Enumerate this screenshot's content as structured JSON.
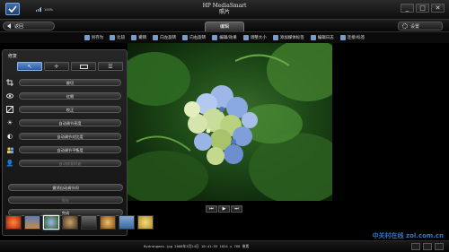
{
  "app": {
    "title_line1": "HP MediaSmart",
    "title_line2": "照片",
    "battery_pct": "100%"
  },
  "window_controls": {
    "minimize": "_",
    "maximize": "□",
    "close": "✕"
  },
  "nav": {
    "back_label": "返回",
    "active_tab": "编辑",
    "settings_label": "设置"
  },
  "toolbar": [
    {
      "label": "另存为",
      "icon": "save-as-icon"
    },
    {
      "label": "比较",
      "icon": "compare-icon"
    },
    {
      "label": "撤销",
      "icon": "undo-icon"
    },
    {
      "label": "向左旋转",
      "icon": "rotate-left-icon"
    },
    {
      "label": "向右旋转",
      "icon": "rotate-right-icon"
    },
    {
      "label": "编辑/效果",
      "icon": "effects-icon"
    },
    {
      "label": "调整大小",
      "icon": "resize-icon"
    },
    {
      "label": "添加媒体标签",
      "icon": "tag-icon"
    },
    {
      "label": "编辑日志",
      "icon": "log-icon"
    },
    {
      "label": "连接/标签",
      "icon": "link-icon"
    }
  ],
  "panel": {
    "title": "修复",
    "actions": [
      {
        "label": "裁切",
        "icon": "crop-icon",
        "enabled": true
      },
      {
        "label": "红眼",
        "icon": "red-eye-icon",
        "enabled": true
      },
      {
        "label": "校正",
        "icon": "straighten-icon",
        "enabled": true
      },
      {
        "label": "自动调节亮度",
        "icon": "brightness-icon",
        "enabled": true
      },
      {
        "label": "自动调节对比度",
        "icon": "contrast-icon",
        "enabled": true
      },
      {
        "label": "自动调节平衡度",
        "icon": "balance-icon",
        "enabled": true
      },
      {
        "label": "自动修复瑕疵",
        "icon": "fix-icon",
        "enabled": false
      }
    ],
    "wide_actions": [
      {
        "label": "撤消自动调节间",
        "enabled": true
      },
      {
        "label": "保存",
        "enabled": false
      },
      {
        "label": "完成",
        "enabled": true
      }
    ]
  },
  "status": {
    "file_info": "Hydrangeas.jpg   2008年3月24日 10:41:55    1024 x 768 像素"
  },
  "watermark": "中关村在线 zol.com.cn",
  "colors": {
    "accent": "#2a5aa0",
    "accent_light": "#8ab4ea",
    "background": "#000000"
  }
}
